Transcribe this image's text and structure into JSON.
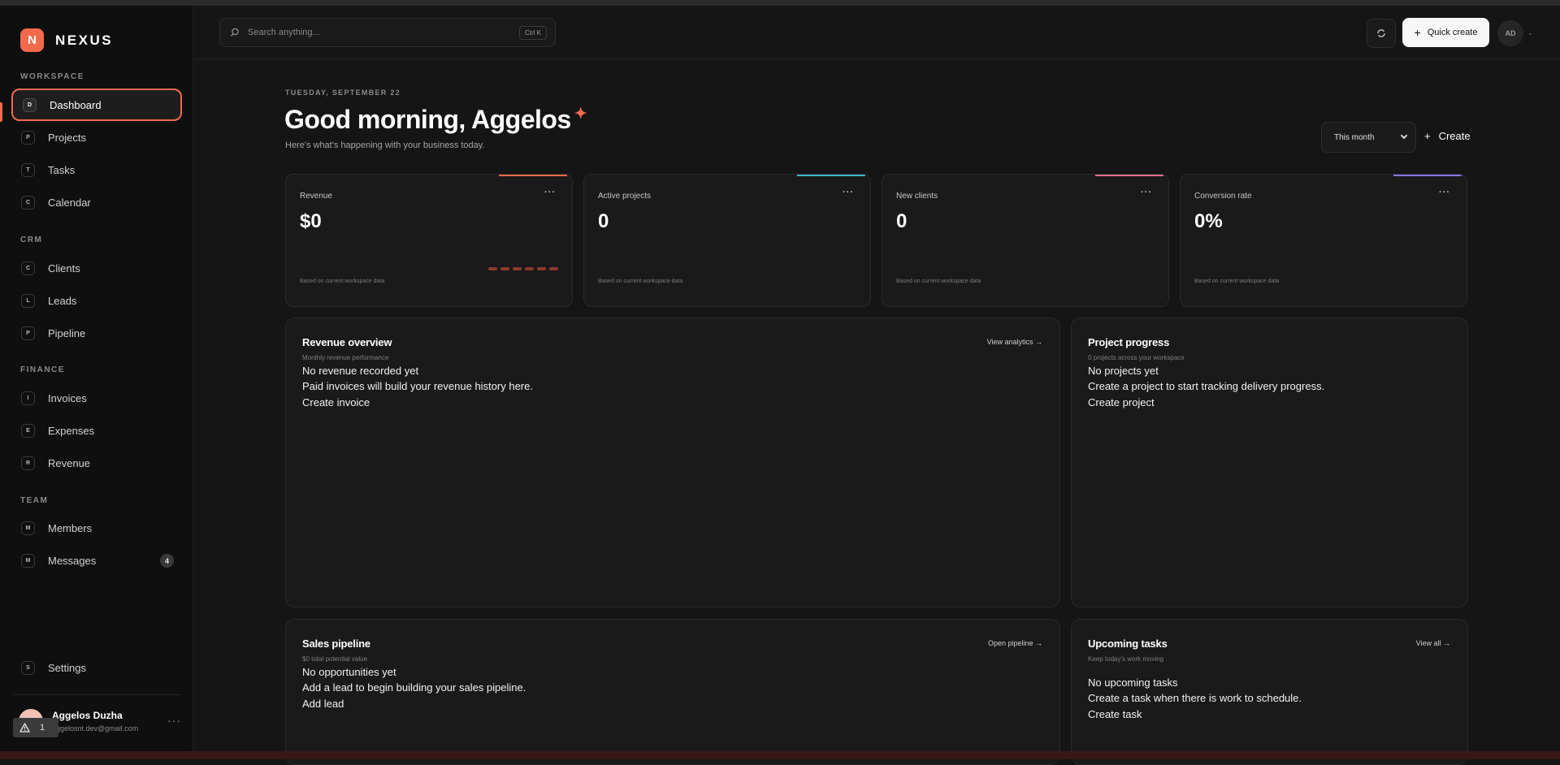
{
  "brand": {
    "logo_letter": "N",
    "name": "NEXUS",
    "accent": "#f26a4b"
  },
  "sidebar": {
    "sections": [
      {
        "label": "WORKSPACE"
      },
      {
        "label": "CRM"
      },
      {
        "label": "FINANCE"
      },
      {
        "label": "TEAM"
      }
    ],
    "items": [
      {
        "letter": "D",
        "label": "Dashboard",
        "active": true
      },
      {
        "letter": "P",
        "label": "Projects"
      },
      {
        "letter": "T",
        "label": "Tasks"
      },
      {
        "letter": "C",
        "label": "Calendar"
      },
      {
        "letter": "C",
        "label": "Clients"
      },
      {
        "letter": "L",
        "label": "Leads"
      },
      {
        "letter": "P",
        "label": "Pipeline"
      },
      {
        "letter": "I",
        "label": "Invoices"
      },
      {
        "letter": "E",
        "label": "Expenses"
      },
      {
        "letter": "R",
        "label": "Revenue"
      },
      {
        "letter": "M",
        "label": "Members"
      },
      {
        "letter": "M",
        "label": "Messages",
        "badge": "4"
      },
      {
        "letter": "S",
        "label": "Settings"
      }
    ],
    "user": {
      "name": "Aggelos Duzha",
      "email": "aggelosnt.dev@gmail.com",
      "more": "···"
    },
    "alert": {
      "icon": "warning-icon",
      "count": "1"
    }
  },
  "header": {
    "search_placeholder": "Search anything...",
    "search_shortcut": "Ctrl K",
    "refresh_icon": "refresh-icon",
    "quick_create": "Quick create",
    "avatar_initials": "AD",
    "avatar_caret": "⌄"
  },
  "main": {
    "date": "TUESDAY, SEPTEMBER 22",
    "greeting": "Good morning, Aggelos",
    "sparkle": "✦",
    "subtitle": "Here's what's happening with your business today.",
    "period": "This month",
    "create": "Create"
  },
  "stats": [
    {
      "label": "Revenue",
      "value": "$0",
      "foot": "Based on current workspace data",
      "accent": "#f26a4b",
      "more": "···"
    },
    {
      "label": "Active projects",
      "value": "0",
      "foot": "Based on current workspace data",
      "accent": "#3fb6c9",
      "more": "···"
    },
    {
      "label": "New clients",
      "value": "0",
      "foot": "Based on current workspace data",
      "accent": "#e9708e",
      "more": "···"
    },
    {
      "label": "Conversion rate",
      "value": "0%",
      "foot": "Based on current workspace data",
      "accent": "#8c74e6",
      "more": "···"
    }
  ],
  "panels": {
    "revenue": {
      "title": "Revenue overview",
      "subtitle": "Monthly revenue performance",
      "link": "View analytics →",
      "empty_title": "No revenue recorded yet",
      "empty_text": "Paid invoices will build your revenue history here.",
      "action": "Create invoice"
    },
    "projects": {
      "title": "Project progress",
      "subtitle": "0 projects across your workspace",
      "empty_title": "No projects yet",
      "empty_text": "Create a project to start tracking delivery progress.",
      "action": "Create project"
    },
    "pipeline": {
      "title": "Sales pipeline",
      "subtitle": "$0 total potential value",
      "link": "Open pipeline →",
      "empty_title": "No opportunities yet",
      "empty_text": "Add a lead to begin building your sales pipeline.",
      "action": "Add lead"
    },
    "tasks": {
      "title": "Upcoming tasks",
      "subtitle": "Keep today's work moving",
      "link": "View all →",
      "empty_title": "No upcoming tasks",
      "empty_text": "Create a task when there is work to schedule.",
      "action": "Create task"
    }
  }
}
